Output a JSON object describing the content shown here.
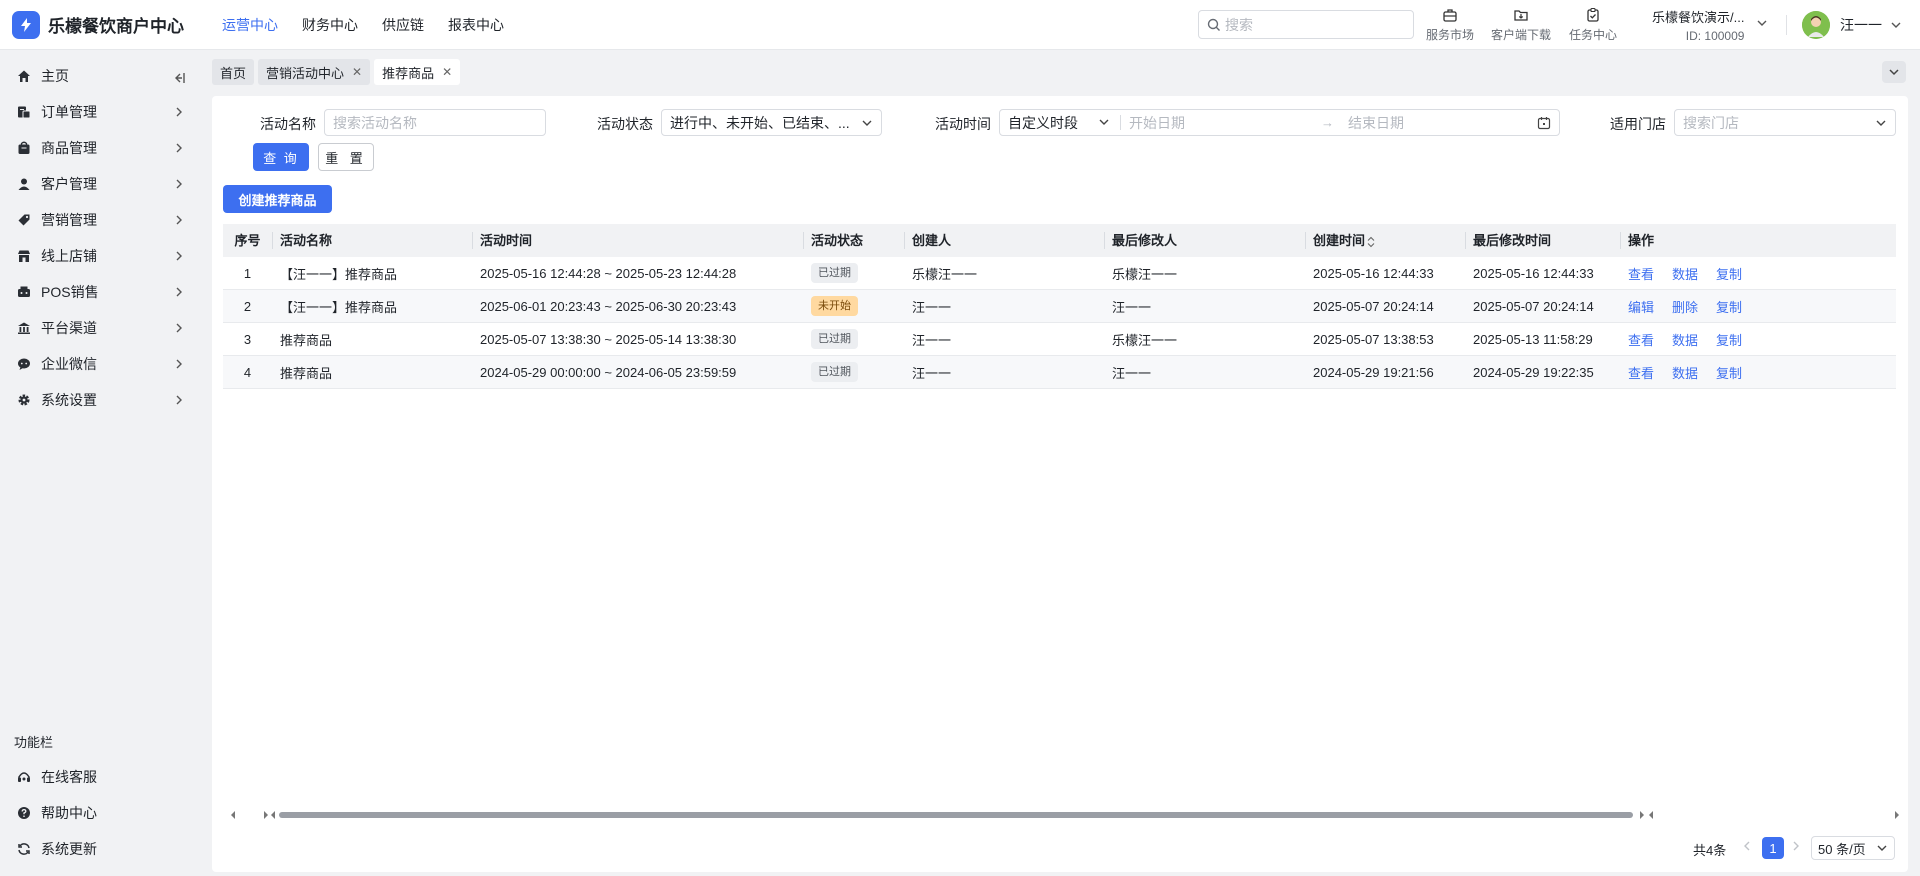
{
  "app": {
    "title": "乐檬餐饮商户中心"
  },
  "topnav": [
    {
      "label": "运营中心",
      "active": true
    },
    {
      "label": "财务中心"
    },
    {
      "label": "供应链"
    },
    {
      "label": "报表中心"
    }
  ],
  "search": {
    "placeholder": "搜索"
  },
  "quick_links": [
    {
      "label": "服务市场",
      "icon": "briefcase-icon"
    },
    {
      "label": "客户端下载",
      "icon": "folder-download-icon"
    },
    {
      "label": "任务中心",
      "icon": "clipboard-check-icon"
    }
  ],
  "org": {
    "name": "乐檬餐饮演示/...",
    "id": "ID: 100009"
  },
  "user": {
    "name": "汪一一"
  },
  "sidebar": {
    "items": [
      {
        "label": "主页",
        "icon": "home-icon"
      },
      {
        "label": "订单管理",
        "icon": "order-icon"
      },
      {
        "label": "商品管理",
        "icon": "product-icon"
      },
      {
        "label": "客户管理",
        "icon": "user-icon"
      },
      {
        "label": "营销管理",
        "icon": "tag-icon"
      },
      {
        "label": "线上店铺",
        "icon": "store-icon"
      },
      {
        "label": "POS销售",
        "icon": "pos-icon"
      },
      {
        "label": "平台渠道",
        "icon": "bank-icon"
      },
      {
        "label": "企业微信",
        "icon": "wechat-icon"
      },
      {
        "label": "系统设置",
        "icon": "gear-icon"
      }
    ],
    "function_title": "功能栏",
    "function_items": [
      {
        "label": "在线客服",
        "icon": "headset-icon"
      },
      {
        "label": "帮助中心",
        "icon": "help-icon"
      },
      {
        "label": "系统更新",
        "icon": "refresh-icon"
      }
    ]
  },
  "tabs": [
    {
      "label": "首页",
      "closable": false
    },
    {
      "label": "营销活动中心",
      "closable": true
    },
    {
      "label": "推荐商品",
      "closable": true,
      "active": true
    }
  ],
  "filters": {
    "name_label": "活动名称",
    "name_placeholder": "搜索活动名称",
    "status_label": "活动状态",
    "status_value": "进行中、未开始、已结束、...",
    "time_label": "活动时间",
    "time_mode": "自定义时段",
    "start_placeholder": "开始日期",
    "end_placeholder": "结束日期",
    "store_label": "适用门店",
    "store_placeholder": "搜索门店",
    "query_button": "查 询",
    "reset_button": "重 置"
  },
  "create_button": "创建推荐商品",
  "table": {
    "columns": [
      "序号",
      "活动名称",
      "活动时间",
      "活动状态",
      "创建人",
      "最后修改人",
      "创建时间",
      "最后修改时间",
      "操作"
    ],
    "rows": [
      {
        "idx": "1",
        "name": "【汪一一】推荐商品",
        "time": "2025-05-16 12:44:28 ~ 2025-05-23 12:44:28",
        "status": "已过期",
        "status_type": "expired",
        "creator": "乐檬汪一一",
        "modifier": "乐檬汪一一",
        "created": "2025-05-16 12:44:33",
        "modified": "2025-05-16 12:44:33",
        "ops": [
          "查看",
          "数据",
          "复制"
        ]
      },
      {
        "idx": "2",
        "name": "【汪一一】推荐商品",
        "time": "2025-06-01 20:23:43 ~ 2025-06-30 20:23:43",
        "status": "未开始",
        "status_type": "pending",
        "creator": "汪一一",
        "modifier": "汪一一",
        "created": "2025-05-07 20:24:14",
        "modified": "2025-05-07 20:24:14",
        "ops": [
          "编辑",
          "删除",
          "复制"
        ]
      },
      {
        "idx": "3",
        "name": "推荐商品",
        "time": "2025-05-07 13:38:30 ~ 2025-05-14 13:38:30",
        "status": "已过期",
        "status_type": "expired",
        "creator": "汪一一",
        "modifier": "乐檬汪一一",
        "created": "2025-05-07 13:38:53",
        "modified": "2025-05-13 11:58:29",
        "ops": [
          "查看",
          "数据",
          "复制"
        ]
      },
      {
        "idx": "4",
        "name": "推荐商品",
        "time": "2024-05-29 00:00:00 ~ 2024-06-05 23:59:59",
        "status": "已过期",
        "status_type": "expired",
        "creator": "汪一一",
        "modifier": "汪一一",
        "created": "2024-05-29 19:21:56",
        "modified": "2024-05-29 19:22:35",
        "ops": [
          "查看",
          "数据",
          "复制"
        ]
      }
    ]
  },
  "pagination": {
    "total": "共4条",
    "current": "1",
    "page_size": "50 条/页"
  },
  "colors": {
    "accent": "#3d6ff0",
    "pending_badge": "#ffd9a0",
    "expired_badge": "#eceef1"
  }
}
